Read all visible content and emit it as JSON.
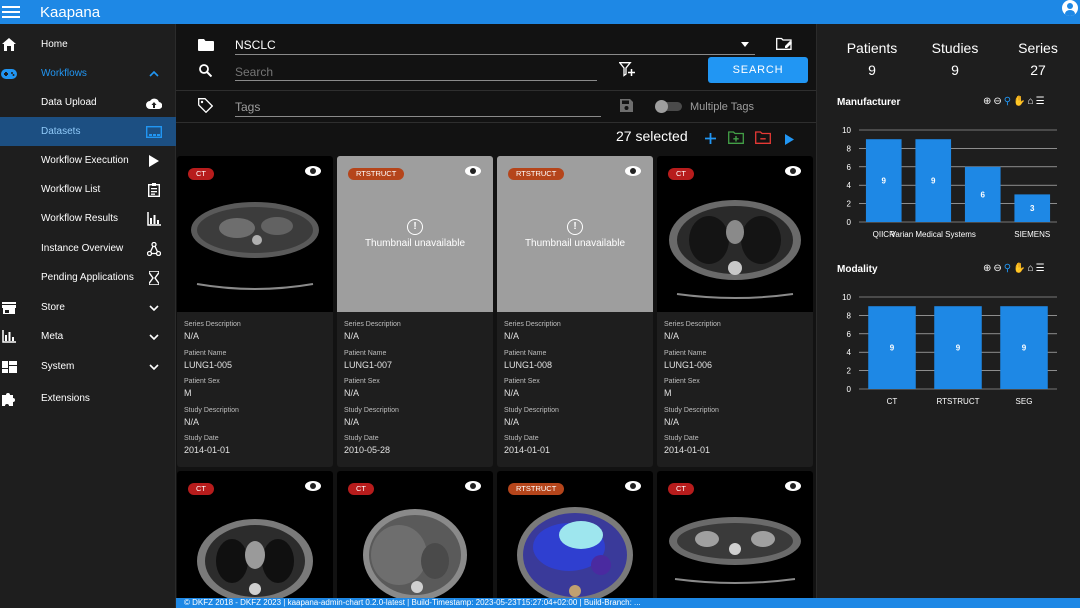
{
  "app": {
    "title": "Kaapana"
  },
  "sidebar": {
    "items": [
      {
        "label": "Home",
        "icon": "home-icon"
      },
      {
        "label": "Workflows",
        "icon": "gamepad-icon"
      },
      {
        "label": "Data Upload",
        "icon": "cloud-upload-icon"
      },
      {
        "label": "Datasets",
        "icon": "view-gallery-icon"
      },
      {
        "label": "Workflow Execution",
        "icon": "play-icon"
      },
      {
        "label": "Workflow List",
        "icon": "clipboard-list-icon"
      },
      {
        "label": "Workflow Results",
        "icon": "chart-box-icon"
      },
      {
        "label": "Instance Overview",
        "icon": "graph-icon"
      },
      {
        "label": "Pending Applications",
        "icon": "hourglass-icon"
      },
      {
        "label": "Store",
        "icon": "store-icon"
      },
      {
        "label": "Meta",
        "icon": "bar-chart-icon"
      },
      {
        "label": "System",
        "icon": "view-dashboard-icon"
      },
      {
        "label": "Extensions",
        "icon": "puzzle-icon"
      }
    ]
  },
  "toolbar": {
    "dataset_value": "NSCLC",
    "search_placeholder": "Search",
    "search_button": "SEARCH",
    "tags_placeholder": "Tags",
    "multiple_tags_label": "Multiple Tags",
    "selected_count": "27 selected"
  },
  "cards": [
    {
      "modality": "CT",
      "thumbnail": true,
      "series_description": "N/A",
      "patient_name": "LUNG1-005",
      "patient_sex": "M",
      "study_description": "N/A",
      "study_date": "2014-01-01"
    },
    {
      "modality": "RTSTRUCT",
      "thumbnail": false,
      "unavailable_text": "Thumbnail unavailable",
      "series_description": "N/A",
      "patient_name": "LUNG1-007",
      "patient_sex": "N/A",
      "study_description": "N/A",
      "study_date": "2010-05-28"
    },
    {
      "modality": "RTSTRUCT",
      "thumbnail": false,
      "unavailable_text": "Thumbnail unavailable",
      "series_description": "N/A",
      "patient_name": "LUNG1-008",
      "patient_sex": "N/A",
      "study_description": "N/A",
      "study_date": "2014-01-01"
    },
    {
      "modality": "CT",
      "thumbnail": true,
      "series_description": "N/A",
      "patient_name": "LUNG1-006",
      "patient_sex": "M",
      "study_description": "N/A",
      "study_date": "2014-01-01"
    },
    {
      "modality": "CT",
      "thumbnail": true
    },
    {
      "modality": "CT",
      "thumbnail": true
    },
    {
      "modality": "RTSTRUCT",
      "thumbnail": true
    },
    {
      "modality": "CT",
      "thumbnail": true
    }
  ],
  "meta_labels": {
    "series_description": "Series Description",
    "patient_name": "Patient Name",
    "patient_sex": "Patient Sex",
    "study_description": "Study Description",
    "study_date": "Study Date"
  },
  "stats": [
    {
      "label": "Patients",
      "value": "9"
    },
    {
      "label": "Studies",
      "value": "9"
    },
    {
      "label": "Series",
      "value": "27"
    }
  ],
  "chart_data": [
    {
      "type": "bar",
      "title": "Manufacturer",
      "categories": [
        "QIICR",
        "Varian Medical Systems",
        "SIEMENS"
      ],
      "tick_labels": [
        "QIICR",
        "Varian Medical Systems",
        "",
        "SIEMENS"
      ],
      "values": [
        9,
        9,
        6,
        3
      ],
      "ylim": [
        0,
        10
      ],
      "yticks": [
        0,
        2,
        4,
        6,
        8,
        10
      ],
      "grid": true,
      "bar_color": "#1e88e5"
    },
    {
      "type": "bar",
      "title": "Modality",
      "categories": [
        "CT",
        "RTSTRUCT",
        "SEG"
      ],
      "values": [
        9,
        9,
        9
      ],
      "ylim": [
        0,
        10
      ],
      "yticks": [
        0,
        2,
        4,
        6,
        8,
        10
      ],
      "grid": true,
      "bar_color": "#1e88e5"
    }
  ],
  "footer": {
    "text": "© DKFZ 2018 - DKFZ 2023 | kaapana-admin-chart 0.2.0-latest | Build-Timestamp: 2023-05-23T15:27:04+02:00 | Build-Branch: ..."
  },
  "colors": {
    "accent": "#1e88e5",
    "ct_badge": "#b71c1c",
    "rtstruct_badge": "#b5451b",
    "active_nav": "#1c4f82"
  }
}
